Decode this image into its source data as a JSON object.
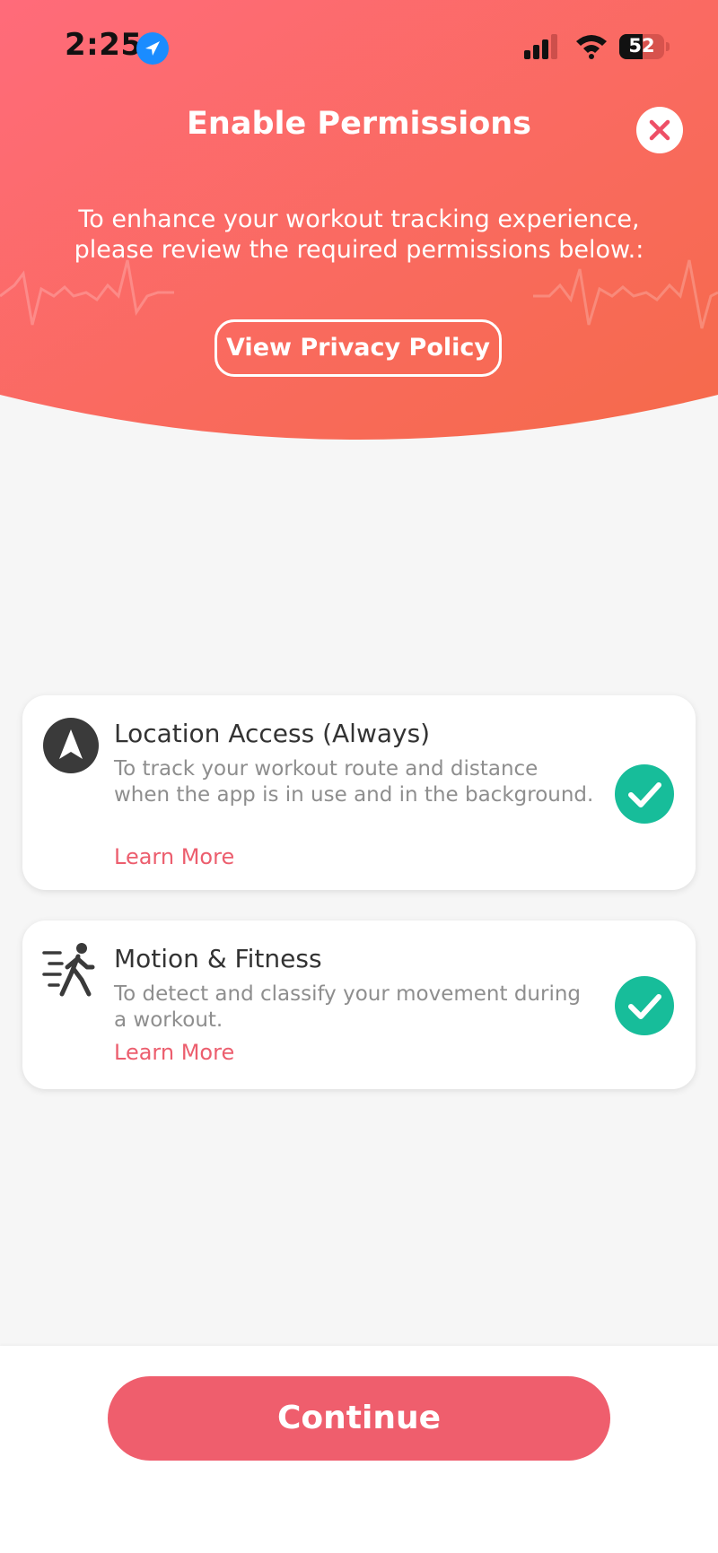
{
  "status_bar": {
    "time": "2:25",
    "battery": "52"
  },
  "header": {
    "title": "Enable Permissions",
    "subtitle": "To enhance your workout tracking experience, please review the required permissions below.:",
    "privacy_button": "View Privacy Policy",
    "gradient_start": "#ff6b7a",
    "gradient_end": "#f56a4a"
  },
  "permissions": [
    {
      "icon": "navigation-arrow-icon",
      "title": "Location Access (Always)",
      "description": "To track your workout route and distance when the app is in use and in the background.",
      "link": "Learn More",
      "granted": true
    },
    {
      "icon": "running-person-icon",
      "title": "Motion & Fitness",
      "description": "To detect and classify your movement during a workout.",
      "link": "Learn More",
      "granted": true
    }
  ],
  "footer": {
    "continue_label": "Continue"
  },
  "colors": {
    "accent": "#ef5e6d",
    "check": "#17bd9a",
    "background": "#f6f6f6"
  }
}
